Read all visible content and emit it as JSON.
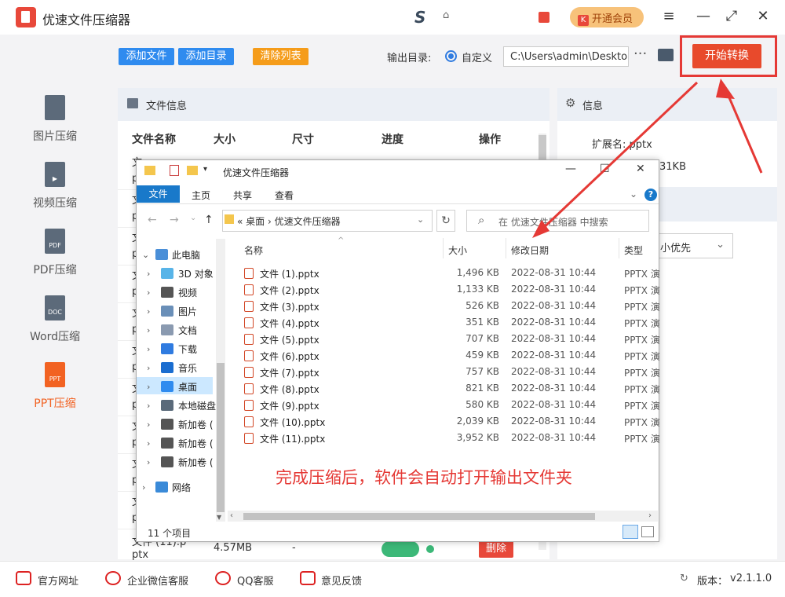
{
  "app": {
    "title": "优速文件压缩器",
    "vip_label": "开通会员",
    "vip_mark": "K",
    "window_controls": [
      "≡",
      "—",
      "⤢",
      "✕"
    ]
  },
  "sidebar": {
    "items": [
      {
        "label": "图片压缩",
        "icon": "image-file-icon",
        "glyph": ""
      },
      {
        "label": "视频压缩",
        "icon": "video-file-icon",
        "glyph": "▶"
      },
      {
        "label": "PDF压缩",
        "icon": "pdf-file-icon",
        "glyph": "PDF"
      },
      {
        "label": "Word压缩",
        "icon": "doc-file-icon",
        "glyph": "DOC"
      },
      {
        "label": "PPT压缩",
        "icon": "ppt-file-icon",
        "glyph": "PPT"
      }
    ],
    "active_index": 4
  },
  "toolbar": {
    "add_file": "添加文件",
    "add_folder": "添加目录",
    "clear_list": "清除列表",
    "output_label": "输出目录:",
    "custom_label": "自定义",
    "output_path": "C:\\Users\\admin\\Deskto",
    "more": "···",
    "start": "开始转换"
  },
  "file_panel": {
    "title": "文件信息",
    "columns": [
      "文件名称",
      "大小",
      "尺寸",
      "进度",
      "操作"
    ],
    "row_name_prefixes": [
      "文",
      "p",
      "文",
      "p",
      "文",
      "p",
      "文",
      "p",
      "文",
      "p",
      "文",
      "p",
      "文",
      "p",
      "文",
      "p",
      "文",
      "p",
      "文",
      "p"
    ],
    "last_row": {
      "name": "文件 (11).p",
      "name2": "ptx",
      "size": "4.57MB",
      "dims": "-",
      "action": "删除"
    }
  },
  "info_panel": {
    "title": "信息",
    "ext_label": "扩展名:",
    "ext_value": "pptx",
    "size_value": "31KB",
    "priority": "小优先"
  },
  "explorer": {
    "title": "优速文件压缩器",
    "ribbon": {
      "file": "文件",
      "tabs": [
        "主页",
        "共享",
        "查看"
      ]
    },
    "breadcrumb": [
      "桌面",
      "优速文件压缩器"
    ],
    "search_placeholder": "在 优速文件压缩器 中搜索",
    "tree": [
      {
        "label": "此电脑",
        "icon": "pc-icon",
        "top_level": true
      },
      {
        "label": "3D 对象",
        "icon": "3d-objects-icon"
      },
      {
        "label": "视频",
        "icon": "videos-folder-icon"
      },
      {
        "label": "图片",
        "icon": "pictures-folder-icon"
      },
      {
        "label": "文档",
        "icon": "documents-folder-icon"
      },
      {
        "label": "下载",
        "icon": "downloads-folder-icon"
      },
      {
        "label": "音乐",
        "icon": "music-folder-icon"
      },
      {
        "label": "桌面",
        "icon": "desktop-folder-icon",
        "selected": true
      },
      {
        "label": "本地磁盘",
        "icon": "local-disk-icon"
      },
      {
        "label": "新加卷 (",
        "icon": "drive-icon"
      },
      {
        "label": "新加卷 (",
        "icon": "drive-icon"
      },
      {
        "label": "新加卷 (",
        "icon": "drive-icon"
      },
      {
        "label": "网络",
        "icon": "network-icon",
        "top_level": true
      }
    ],
    "columns": [
      "名称",
      "大小",
      "修改日期",
      "类型"
    ],
    "files": [
      {
        "name": "文件 (1).pptx",
        "size": "1,496 KB",
        "date": "2022-08-31 10:44",
        "type": "PPTX 演"
      },
      {
        "name": "文件 (2).pptx",
        "size": "1,133 KB",
        "date": "2022-08-31 10:44",
        "type": "PPTX 演"
      },
      {
        "name": "文件 (3).pptx",
        "size": "526 KB",
        "date": "2022-08-31 10:44",
        "type": "PPTX 演"
      },
      {
        "name": "文件 (4).pptx",
        "size": "351 KB",
        "date": "2022-08-31 10:44",
        "type": "PPTX 演"
      },
      {
        "name": "文件 (5).pptx",
        "size": "707 KB",
        "date": "2022-08-31 10:44",
        "type": "PPTX 演"
      },
      {
        "name": "文件 (6).pptx",
        "size": "459 KB",
        "date": "2022-08-31 10:44",
        "type": "PPTX 演"
      },
      {
        "name": "文件 (7).pptx",
        "size": "757 KB",
        "date": "2022-08-31 10:44",
        "type": "PPTX 演"
      },
      {
        "name": "文件 (8).pptx",
        "size": "821 KB",
        "date": "2022-08-31 10:44",
        "type": "PPTX 演"
      },
      {
        "name": "文件 (9).pptx",
        "size": "580 KB",
        "date": "2022-08-31 10:44",
        "type": "PPTX 演"
      },
      {
        "name": "文件 (10).pptx",
        "size": "2,039 KB",
        "date": "2022-08-31 10:44",
        "type": "PPTX 演"
      },
      {
        "name": "文件 (11).pptx",
        "size": "3,952 KB",
        "date": "2022-08-31 10:44",
        "type": "PPTX 演"
      }
    ],
    "status": "11 个项目",
    "annotation": "完成压缩后，软件会自动打开输出文件夹"
  },
  "bottom": {
    "links": [
      "官方网址",
      "企业微信客服",
      "QQ客服",
      "意见反馈"
    ],
    "version_label": "版本：",
    "version": "v2.1.1.0"
  },
  "colors": {
    "accent": "#e84a2c",
    "blue": "#2f8bef",
    "orange": "#f59c1a",
    "annotation": "#e53935"
  }
}
